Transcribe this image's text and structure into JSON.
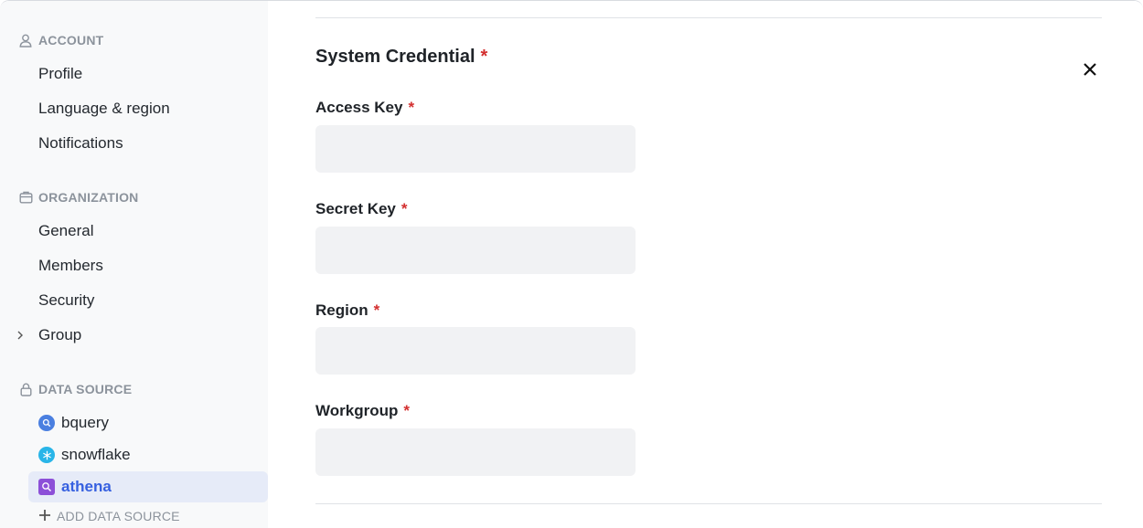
{
  "sidebar": {
    "account": {
      "title": "ACCOUNT",
      "icon": "user-icon",
      "items": [
        {
          "label": "Profile"
        },
        {
          "label": "Language & region"
        },
        {
          "label": "Notifications"
        }
      ]
    },
    "organization": {
      "title": "ORGANIZATION",
      "icon": "building-icon",
      "items": [
        {
          "label": "General"
        },
        {
          "label": "Members"
        },
        {
          "label": "Security"
        },
        {
          "label": "Group",
          "icon": "chevron-right-icon"
        }
      ]
    },
    "data_source": {
      "title": "DATA SOURCE",
      "icon": "lock-icon",
      "items": [
        {
          "label": "bquery",
          "icon": "bigquery-icon",
          "color": "#4a7fe0"
        },
        {
          "label": "snowflake",
          "icon": "snowflake-icon",
          "color": "#29b5e8"
        },
        {
          "label": "athena",
          "icon": "athena-icon",
          "color": "#8c4fd8",
          "active": true
        }
      ],
      "add_label": "ADD DATA SOURCE"
    }
  },
  "form": {
    "title": "System Credential",
    "required_mark": "*",
    "fields": [
      {
        "label": "Access Key",
        "value": "",
        "placeholder": ""
      },
      {
        "label": "Secret Key",
        "value": "",
        "placeholder": ""
      },
      {
        "label": "Region",
        "value": "",
        "placeholder": ""
      },
      {
        "label": "Workgroup",
        "value": "",
        "placeholder": ""
      }
    ]
  },
  "colors": {
    "accent": "#3660e0",
    "required": "#d32f2f",
    "sidebar_bg": "#f8f9fa",
    "active_item_bg": "#e6ebf8"
  }
}
